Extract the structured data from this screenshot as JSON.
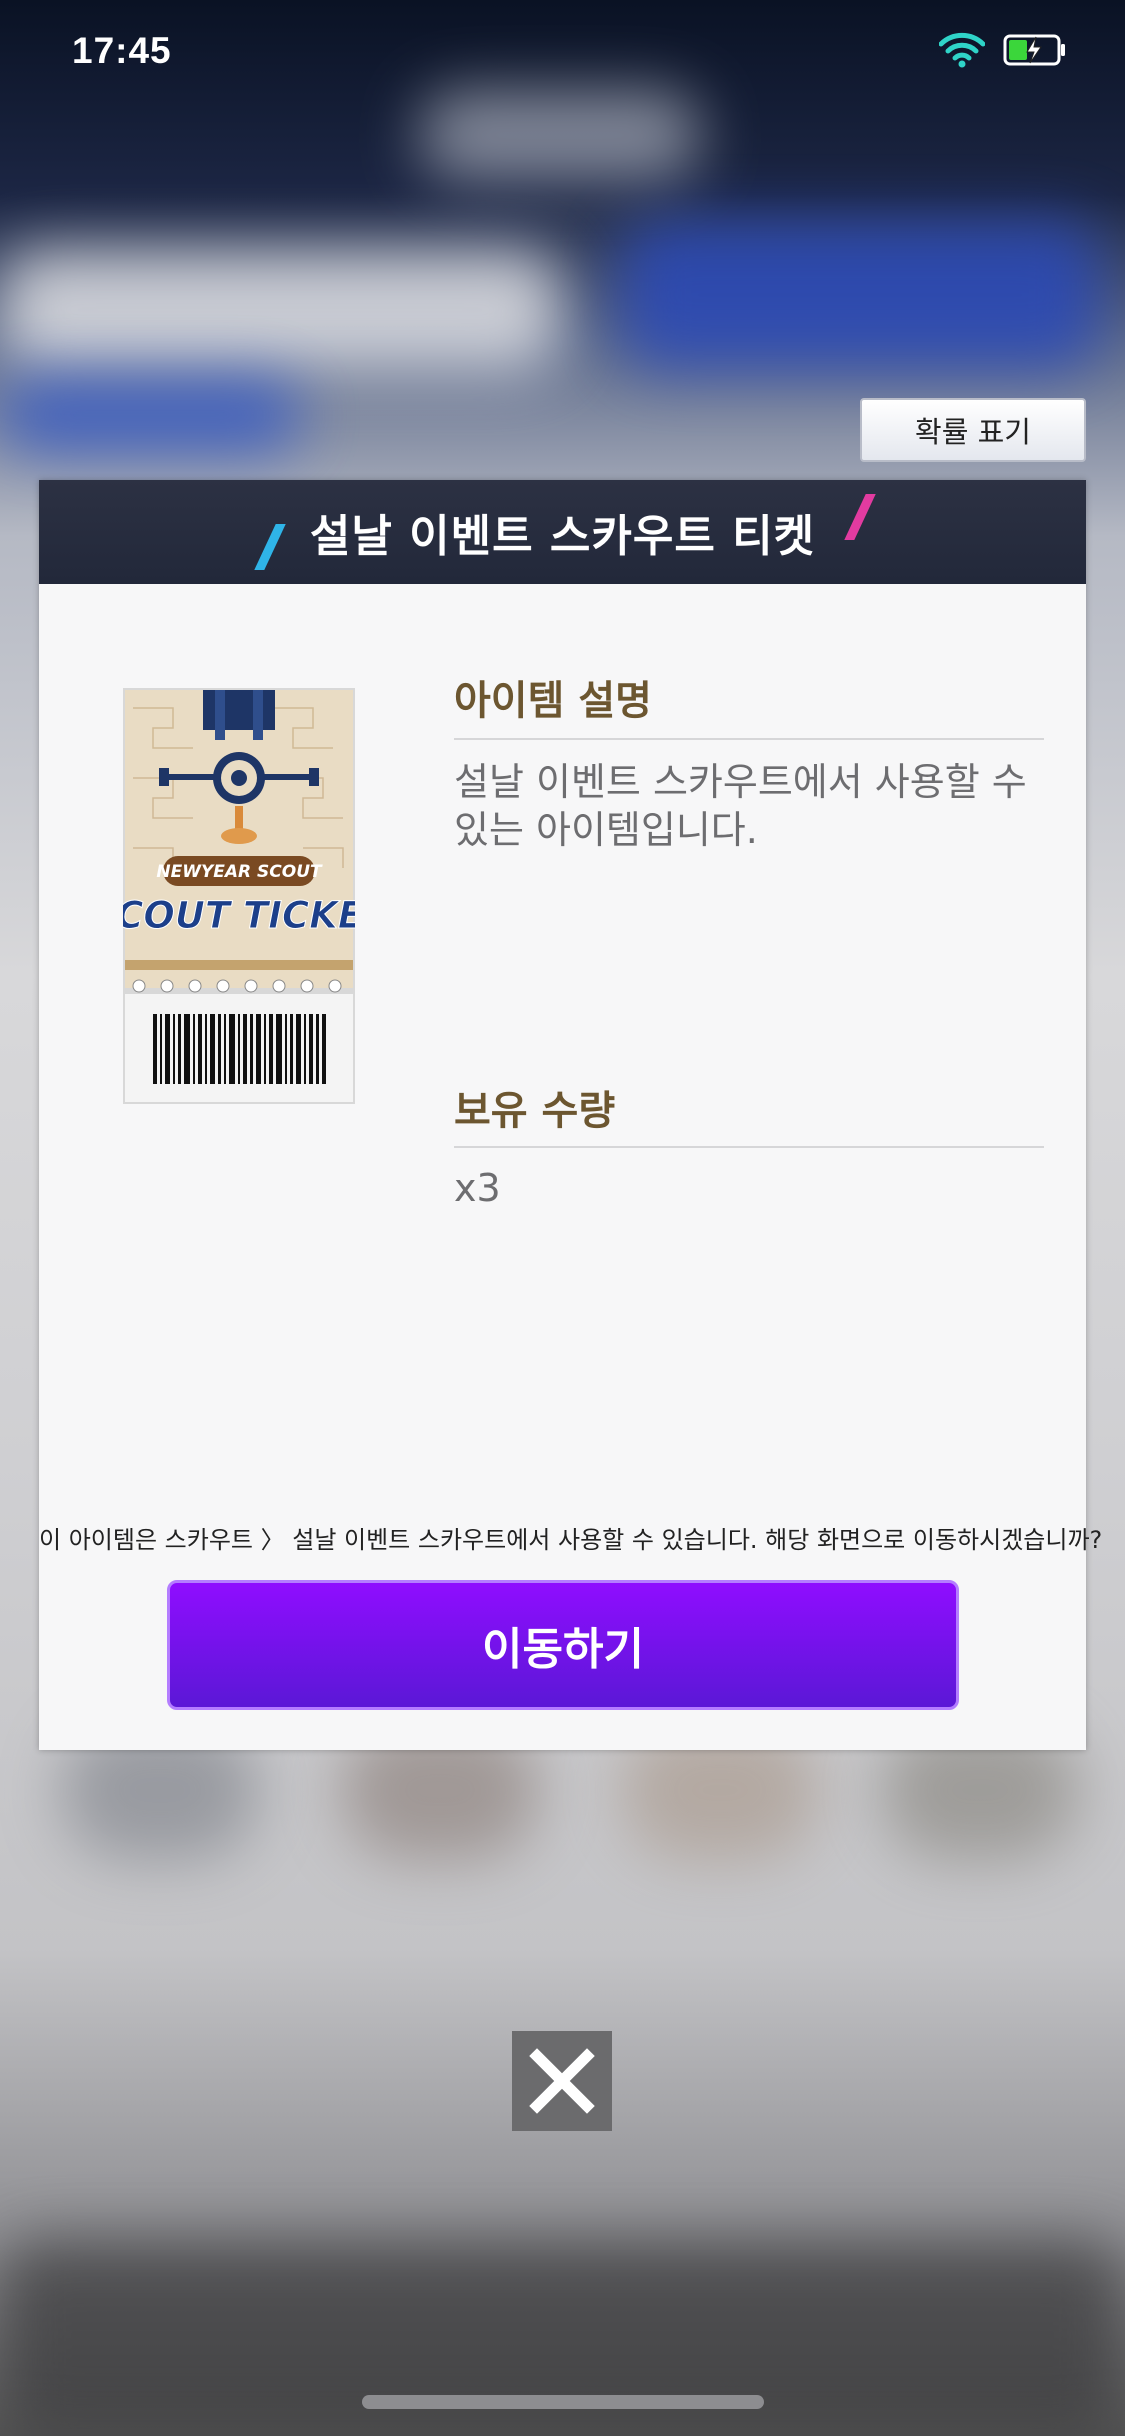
{
  "status_bar": {
    "time": "17:45",
    "icons": [
      "wifi-icon",
      "battery-charging-icon"
    ]
  },
  "dialog": {
    "probability_button_label": "확률 표기",
    "title": "설날 이벤트 스카우트 티켓",
    "item_image": {
      "icon": "scout-ticket-image",
      "subtitle_text": "NEWYEAR SCOUT",
      "title_text": "SCOUT TICKET"
    },
    "description_label": "아이템 설명",
    "description_text": "설날 이벤트 스카우트에서 사용할 수 있는 아이템입니다.",
    "quantity_label": "보유 수량",
    "quantity_value": "x3",
    "notice": "이 아이템은 스카우트 〉 설날 이벤트 스카우트에서 사용할 수 있습니다. 해당 화면으로 이동하시겠습니까?",
    "go_button_label": "이동하기"
  },
  "close_button": {
    "icon": "close-icon"
  },
  "colors": {
    "header_bg": "#262c3e",
    "accent_purple": "#7a12f0",
    "label_brown": "#6c5630",
    "slash_blue": "#2fb4e8",
    "slash_pink": "#e23ba0"
  }
}
